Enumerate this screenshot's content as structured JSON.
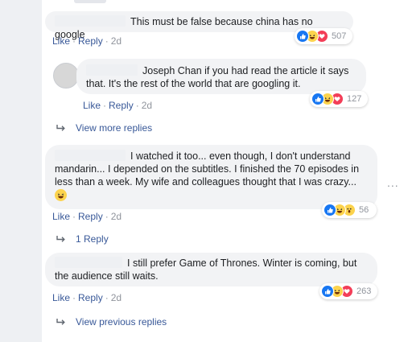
{
  "comments": [
    {
      "text": "This must be false because china has no google",
      "actions": {
        "like": "Like",
        "reply": "Reply",
        "time": "2d"
      },
      "reactions": {
        "count": "507"
      }
    },
    {
      "text": "Joseph Chan if you had read the article it says that. It's the rest of the world that are googling it.",
      "actions": {
        "like": "Like",
        "reply": "Reply",
        "time": "2d"
      },
      "reactions": {
        "count": "127"
      }
    },
    {
      "text": "I watched it too... even though, I don't understand mandarin... I depended on the subtitles. I finished the 70 episodes in less than a week. My wife and colleagues thought that I was crazy...",
      "actions": {
        "like": "Like",
        "reply": "Reply",
        "time": "2d"
      },
      "reactions": {
        "count": "56"
      }
    },
    {
      "text": "I still prefer Game of Thrones. Winter is coming, but the audience still waits.",
      "actions": {
        "like": "Like",
        "reply": "Reply",
        "time": "2d"
      },
      "reactions": {
        "count": "263"
      }
    }
  ],
  "view_more_replies": "View more replies",
  "one_reply": "1 Reply",
  "view_previous_replies": "View previous replies",
  "more_options": "...",
  "colors": {
    "link": "#385898",
    "muted": "#90949c",
    "bubble": "#f2f3f5",
    "like": "#1877f2",
    "love": "#f33e58",
    "haha": "#fcd34d"
  }
}
